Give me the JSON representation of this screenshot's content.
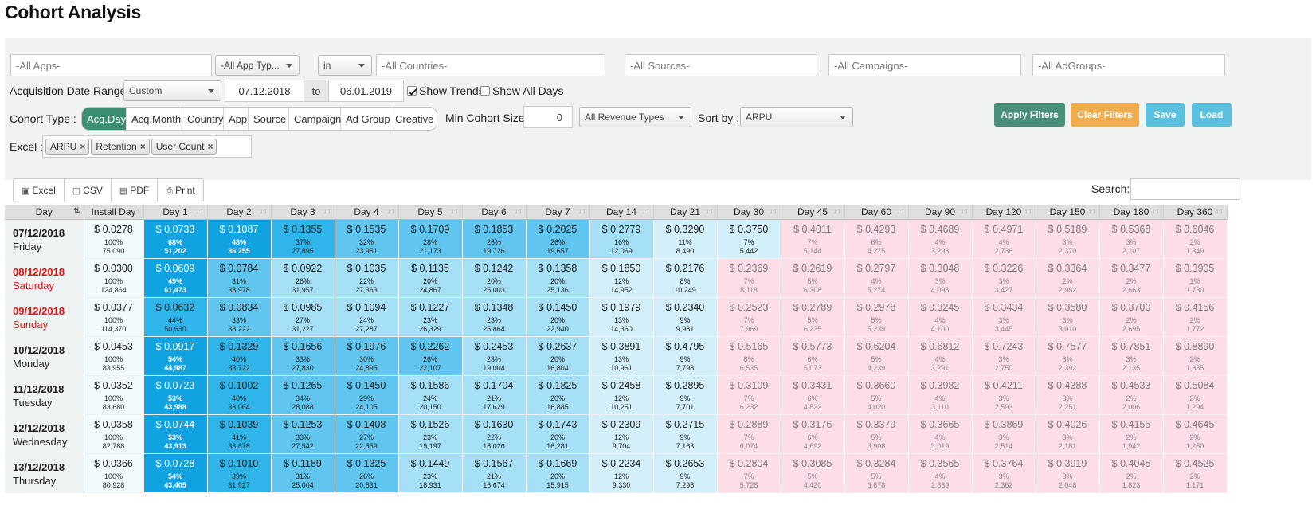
{
  "title": "Cohort Analysis",
  "filters": {
    "apps_placeholder": "-All Apps-",
    "app_types_placeholder": "-All App Typ...",
    "country_op": "in",
    "countries_placeholder": "-All Countries-",
    "sources_placeholder": "-All Sources-",
    "campaigns_placeholder": "-All Campaigns-",
    "adgroups_placeholder": "-All AdGroups-",
    "date_range_label": "Acquisition Date Range :",
    "date_range_preset": "Custom",
    "date_from": "07.12.2018",
    "date_to_label": "to",
    "date_to": "06.01.2019",
    "show_trends_label": "Show Trends",
    "show_trends_checked": true,
    "show_all_days_label": "Show All Days",
    "show_all_days_checked": false,
    "cohort_type_label": "Cohort Type :",
    "cohort_types": [
      "Acq.Day",
      "Acq.Month",
      "Country",
      "App",
      "Source",
      "Campaign",
      "Ad Group",
      "Creative"
    ],
    "cohort_type_active": "Acq.Day",
    "min_cohort_label": "Min Cohort Size:",
    "min_cohort_value": "0",
    "revenue_type": "All Revenue Types",
    "sort_by_label": "Sort by :",
    "sort_by_value": "ARPU",
    "excel_label": "Excel :",
    "excel_tags": [
      "ARPU",
      "Retention",
      "User Count"
    ]
  },
  "buttons": {
    "apply": "Apply Filters",
    "clear": "Clear Filters",
    "save": "Save",
    "load": "Load"
  },
  "colors": {
    "apply": "#4a8f7a",
    "clear": "#f0ad4e",
    "save": "#5bc0de",
    "load": "#5bc0de",
    "active_segment": "#3a8f73",
    "weekend_text": "#e01212"
  },
  "export": {
    "buttons": [
      {
        "label": "Excel",
        "icon": "excel-file-icon"
      },
      {
        "label": "CSV",
        "icon": "file-icon"
      },
      {
        "label": "PDF",
        "icon": "pdf-file-icon"
      },
      {
        "label": "Print",
        "icon": "print-icon"
      }
    ],
    "search_label": "Search:"
  },
  "table": {
    "columns": [
      "Day",
      "Install Day",
      "Day 1",
      "Day 2",
      "Day 3",
      "Day 4",
      "Day 5",
      "Day 6",
      "Day 7",
      "Day 14",
      "Day 21",
      "Day 30",
      "Day 45",
      "Day 60",
      "Day 90",
      "Day 120",
      "Day 150",
      "Day 180",
      "Day 360"
    ],
    "rows": [
      {
        "date": "07/12/2018",
        "day": "Friday",
        "weekend": false,
        "cells": [
          [
            "$ 0.0278",
            "100%",
            "75,090",
            "t0"
          ],
          [
            "$ 0.0733",
            "68%",
            "51,202",
            "t5"
          ],
          [
            "$ 0.1087",
            "48%",
            "36,255",
            "t5"
          ],
          [
            "$ 0.1355",
            "37%",
            "27,895",
            "t4"
          ],
          [
            "$ 0.1535",
            "32%",
            "23,951",
            "t3"
          ],
          [
            "$ 0.1709",
            "28%",
            "21,173",
            "t3"
          ],
          [
            "$ 0.1853",
            "26%",
            "19,726",
            "t3"
          ],
          [
            "$ 0.2025",
            "26%",
            "19,657",
            "t3"
          ],
          [
            "$ 0.2779",
            "16%",
            "12,069",
            "t2"
          ],
          [
            "$ 0.3290",
            "11%",
            "8,490",
            "t1"
          ],
          [
            "$ 0.3750",
            "7%",
            "5,442",
            "t1"
          ],
          [
            "$ 0.4011",
            "7%",
            "5,144",
            "t6"
          ],
          [
            "$ 0.4293",
            "6%",
            "4,275",
            "t6"
          ],
          [
            "$ 0.4689",
            "4%",
            "3,293",
            "t6"
          ],
          [
            "$ 0.4971",
            "4%",
            "2,736",
            "t6"
          ],
          [
            "$ 0.5189",
            "3%",
            "2,370",
            "t6"
          ],
          [
            "$ 0.5368",
            "3%",
            "2,107",
            "t6"
          ],
          [
            "$ 0.6046",
            "2%",
            "1,349",
            "t6"
          ]
        ]
      },
      {
        "date": "08/12/2018",
        "day": "Saturday",
        "weekend": true,
        "cells": [
          [
            "$ 0.0300",
            "100%",
            "124,864",
            "t0"
          ],
          [
            "$ 0.0609",
            "49%",
            "61,473",
            "t5"
          ],
          [
            "$ 0.0784",
            "31%",
            "38,978",
            "t3"
          ],
          [
            "$ 0.0922",
            "26%",
            "31,957",
            "t2"
          ],
          [
            "$ 0.1035",
            "22%",
            "27,363",
            "t2"
          ],
          [
            "$ 0.1135",
            "20%",
            "24,867",
            "t2"
          ],
          [
            "$ 0.1242",
            "20%",
            "25,003",
            "t2"
          ],
          [
            "$ 0.1358",
            "20%",
            "25,136",
            "t2"
          ],
          [
            "$ 0.1850",
            "12%",
            "14,952",
            "t1"
          ],
          [
            "$ 0.2176",
            "8%",
            "10,249",
            "t1"
          ],
          [
            "$ 0.2369",
            "7%",
            "8,118",
            "t6"
          ],
          [
            "$ 0.2619",
            "5%",
            "6,308",
            "t6"
          ],
          [
            "$ 0.2797",
            "4%",
            "5,274",
            "t6"
          ],
          [
            "$ 0.3048",
            "3%",
            "4,098",
            "t6"
          ],
          [
            "$ 0.3226",
            "3%",
            "3,427",
            "t6"
          ],
          [
            "$ 0.3364",
            "2%",
            "2,982",
            "t6"
          ],
          [
            "$ 0.3477",
            "2%",
            "2,663",
            "t6"
          ],
          [
            "$ 0.3905",
            "1%",
            "1,730",
            "t6"
          ]
        ]
      },
      {
        "date": "09/12/2018",
        "day": "Sunday",
        "weekend": true,
        "cells": [
          [
            "$ 0.0377",
            "100%",
            "114,370",
            "t0"
          ],
          [
            "$ 0.0632",
            "44%",
            "50,630",
            "t4"
          ],
          [
            "$ 0.0834",
            "33%",
            "38,222",
            "t3"
          ],
          [
            "$ 0.0985",
            "27%",
            "31,227",
            "t2"
          ],
          [
            "$ 0.1094",
            "24%",
            "27,287",
            "t2"
          ],
          [
            "$ 0.1227",
            "23%",
            "26,329",
            "t2"
          ],
          [
            "$ 0.1348",
            "23%",
            "25,864",
            "t2"
          ],
          [
            "$ 0.1450",
            "20%",
            "22,940",
            "t2"
          ],
          [
            "$ 0.1979",
            "13%",
            "14,360",
            "t1"
          ],
          [
            "$ 0.2340",
            "9%",
            "9,981",
            "t1"
          ],
          [
            "$ 0.2523",
            "7%",
            "7,969",
            "t6"
          ],
          [
            "$ 0.2789",
            "5%",
            "6,235",
            "t6"
          ],
          [
            "$ 0.2978",
            "5%",
            "5,239",
            "t6"
          ],
          [
            "$ 0.3245",
            "4%",
            "4,100",
            "t6"
          ],
          [
            "$ 0.3434",
            "3%",
            "3,445",
            "t6"
          ],
          [
            "$ 0.3580",
            "3%",
            "3,010",
            "t6"
          ],
          [
            "$ 0.3700",
            "2%",
            "2,695",
            "t6"
          ],
          [
            "$ 0.4156",
            "2%",
            "1,772",
            "t6"
          ]
        ]
      },
      {
        "date": "10/12/2018",
        "day": "Monday",
        "weekend": false,
        "cells": [
          [
            "$ 0.0453",
            "100%",
            "83,955",
            "t0"
          ],
          [
            "$ 0.0917",
            "54%",
            "44,987",
            "t5"
          ],
          [
            "$ 0.1329",
            "40%",
            "33,722",
            "t4"
          ],
          [
            "$ 0.1656",
            "33%",
            "27,830",
            "t3"
          ],
          [
            "$ 0.1976",
            "30%",
            "24,895",
            "t3"
          ],
          [
            "$ 0.2262",
            "26%",
            "22,107",
            "t3"
          ],
          [
            "$ 0.2453",
            "23%",
            "19,004",
            "t2"
          ],
          [
            "$ 0.2637",
            "20%",
            "16,804",
            "t2"
          ],
          [
            "$ 0.3891",
            "13%",
            "10,961",
            "t1"
          ],
          [
            "$ 0.4795",
            "9%",
            "7,798",
            "t1"
          ],
          [
            "$ 0.5165",
            "8%",
            "6,535",
            "t6"
          ],
          [
            "$ 0.5773",
            "6%",
            "5,073",
            "t6"
          ],
          [
            "$ 0.6204",
            "5%",
            "4,239",
            "t6"
          ],
          [
            "$ 0.6812",
            "4%",
            "3,291",
            "t6"
          ],
          [
            "$ 0.7243",
            "3%",
            "2,750",
            "t6"
          ],
          [
            "$ 0.7577",
            "3%",
            "2,392",
            "t6"
          ],
          [
            "$ 0.7851",
            "3%",
            "2,135",
            "t6"
          ],
          [
            "$ 0.8890",
            "2%",
            "1,385",
            "t6"
          ]
        ]
      },
      {
        "date": "11/12/2018",
        "day": "Tuesday",
        "weekend": false,
        "cells": [
          [
            "$ 0.0352",
            "100%",
            "83,680",
            "t0"
          ],
          [
            "$ 0.0723",
            "53%",
            "43,988",
            "t5"
          ],
          [
            "$ 0.1002",
            "40%",
            "33,064",
            "t4"
          ],
          [
            "$ 0.1265",
            "34%",
            "28,088",
            "t3"
          ],
          [
            "$ 0.1450",
            "29%",
            "24,105",
            "t3"
          ],
          [
            "$ 0.1586",
            "24%",
            "20,150",
            "t2"
          ],
          [
            "$ 0.1704",
            "21%",
            "17,629",
            "t2"
          ],
          [
            "$ 0.1825",
            "20%",
            "16,885",
            "t2"
          ],
          [
            "$ 0.2458",
            "12%",
            "10,251",
            "t1"
          ],
          [
            "$ 0.2895",
            "9%",
            "7,701",
            "t1"
          ],
          [
            "$ 0.3109",
            "7%",
            "6,232",
            "t6"
          ],
          [
            "$ 0.3431",
            "6%",
            "4,822",
            "t6"
          ],
          [
            "$ 0.3660",
            "5%",
            "4,020",
            "t6"
          ],
          [
            "$ 0.3982",
            "4%",
            "3,110",
            "t6"
          ],
          [
            "$ 0.4211",
            "3%",
            "2,593",
            "t6"
          ],
          [
            "$ 0.4388",
            "3%",
            "2,251",
            "t6"
          ],
          [
            "$ 0.4533",
            "2%",
            "2,006",
            "t6"
          ],
          [
            "$ 0.5084",
            "2%",
            "1,294",
            "t6"
          ]
        ]
      },
      {
        "date": "12/12/2018",
        "day": "Wednesday",
        "weekend": false,
        "cells": [
          [
            "$ 0.0358",
            "100%",
            "82,788",
            "t0"
          ],
          [
            "$ 0.0744",
            "53%",
            "43,913",
            "t5"
          ],
          [
            "$ 0.1039",
            "41%",
            "33,676",
            "t4"
          ],
          [
            "$ 0.1253",
            "33%",
            "27,542",
            "t3"
          ],
          [
            "$ 0.1408",
            "27%",
            "22,559",
            "t3"
          ],
          [
            "$ 0.1526",
            "23%",
            "19,197",
            "t2"
          ],
          [
            "$ 0.1630",
            "22%",
            "18,026",
            "t2"
          ],
          [
            "$ 0.1743",
            "20%",
            "16,281",
            "t2"
          ],
          [
            "$ 0.2309",
            "12%",
            "9,704",
            "t1"
          ],
          [
            "$ 0.2715",
            "9%",
            "7,163",
            "t1"
          ],
          [
            "$ 0.2889",
            "7%",
            "6,074",
            "t6"
          ],
          [
            "$ 0.3176",
            "6%",
            "4,692",
            "t6"
          ],
          [
            "$ 0.3379",
            "5%",
            "3,908",
            "t6"
          ],
          [
            "$ 0.3665",
            "4%",
            "3,019",
            "t6"
          ],
          [
            "$ 0.3869",
            "3%",
            "2,514",
            "t6"
          ],
          [
            "$ 0.4026",
            "3%",
            "2,181",
            "t6"
          ],
          [
            "$ 0.4155",
            "2%",
            "1,942",
            "t6"
          ],
          [
            "$ 0.4645",
            "2%",
            "1,250",
            "t6"
          ]
        ]
      },
      {
        "date": "13/12/2018",
        "day": "Thursday",
        "weekend": false,
        "cells": [
          [
            "$ 0.0366",
            "100%",
            "80,928",
            "t0"
          ],
          [
            "$ 0.0728",
            "54%",
            "43,405",
            "t5"
          ],
          [
            "$ 0.1010",
            "39%",
            "31,927",
            "t4"
          ],
          [
            "$ 0.1189",
            "31%",
            "25,004",
            "t3"
          ],
          [
            "$ 0.1325",
            "26%",
            "20,831",
            "t3"
          ],
          [
            "$ 0.1449",
            "23%",
            "18,931",
            "t2"
          ],
          [
            "$ 0.1567",
            "21%",
            "16,674",
            "t2"
          ],
          [
            "$ 0.1669",
            "20%",
            "15,915",
            "t2"
          ],
          [
            "$ 0.2234",
            "12%",
            "9,330",
            "t1"
          ],
          [
            "$ 0.2653",
            "9%",
            "7,298",
            "t1"
          ],
          [
            "$ 0.2804",
            "7%",
            "5,728",
            "t6"
          ],
          [
            "$ 0.3085",
            "5%",
            "4,420",
            "t6"
          ],
          [
            "$ 0.3284",
            "5%",
            "3,678",
            "t6"
          ],
          [
            "$ 0.3565",
            "4%",
            "2,839",
            "t6"
          ],
          [
            "$ 0.3764",
            "3%",
            "2,362",
            "t6"
          ],
          [
            "$ 0.3919",
            "3%",
            "2,048",
            "t6"
          ],
          [
            "$ 0.4045",
            "2%",
            "1,823",
            "t6"
          ],
          [
            "$ 0.4525",
            "2%",
            "1,171",
            "t6"
          ]
        ]
      }
    ]
  }
}
